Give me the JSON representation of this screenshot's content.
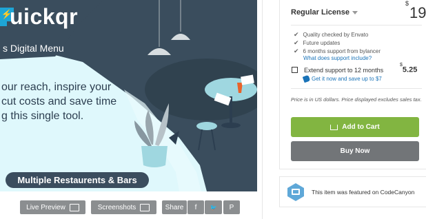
{
  "preview": {
    "logo_text": "uickqr",
    "subtitle": "s Digital Menu",
    "hero_lines": [
      "our reach, inspire your",
      "cut costs and save time",
      "g this single tool."
    ],
    "banner": "Multiple Restaurents & Bars"
  },
  "preview_buttons": {
    "live_preview": "Live Preview",
    "screenshots": "Screenshots",
    "share": "Share",
    "facebook": "f",
    "twitter": "🐦",
    "pinterest": "P"
  },
  "license": {
    "name": "Regular License",
    "currency": "$",
    "price": "19",
    "features": [
      "Quality checked by Envato",
      "Future updates",
      "6 months support from bylancer"
    ],
    "support_link": "What does support include?",
    "extend_label": "Extend support to 12 months",
    "extend_currency": "$",
    "extend_price": "5.25",
    "extend_save": "Get it now and save up to $7",
    "price_note": "Price is in US dollars. Price displayed excludes sales tax.",
    "add_to_cart": "Add to Cart",
    "buy_now": "Buy Now"
  },
  "featured": {
    "text": "This item was featured on CodeCanyon"
  },
  "colors": {
    "primary_green": "#82b541",
    "buy_gray": "#727578",
    "link_blue": "#1a73b8",
    "preview_dark": "#3a4d5d"
  }
}
